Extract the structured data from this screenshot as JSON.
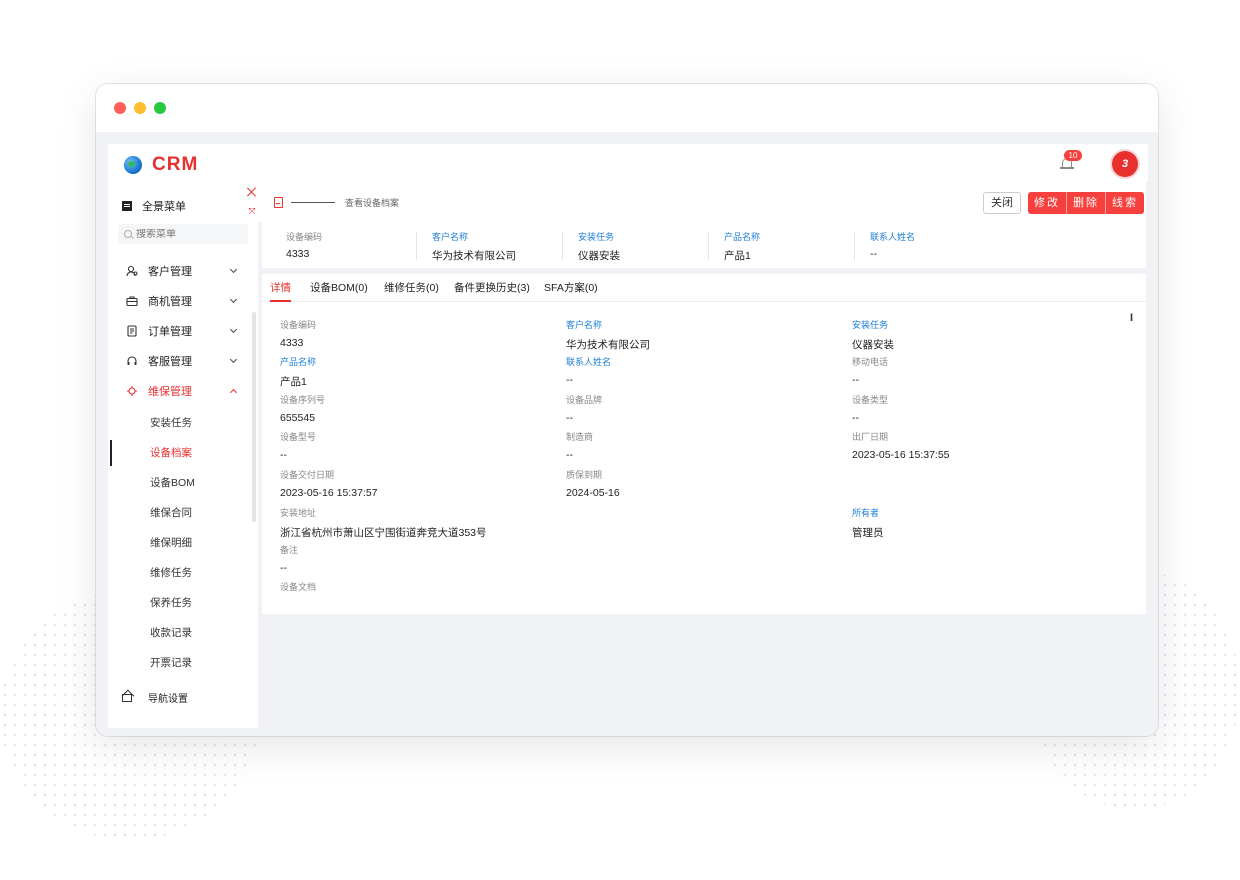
{
  "app": {
    "logo": "CRM",
    "notification_count": "10",
    "avatar_text": "3"
  },
  "sidebar": {
    "title": "全景菜单",
    "search_placeholder": "搜索菜单",
    "groups": [
      {
        "label": "客户管理",
        "icon": "customer-icon"
      },
      {
        "label": "商机管理",
        "icon": "briefcase-icon"
      },
      {
        "label": "订单管理",
        "icon": "order-icon"
      },
      {
        "label": "客服管理",
        "icon": "headset-icon"
      },
      {
        "label": "维保管理",
        "icon": "maintenance-icon"
      }
    ],
    "sub_items": [
      "安装任务",
      "设备档案",
      "设备BOM",
      "维保合同",
      "维保明细",
      "维修任务",
      "保养任务",
      "收款记录",
      "开票记录"
    ],
    "footer": "导航设置"
  },
  "header_card": {
    "breadcrumb": "查看设备档案",
    "buttons": {
      "close": "关闭",
      "edit": "修改",
      "delete": "删除",
      "clue": "线索"
    },
    "summary": [
      {
        "label": "设备编码",
        "value": "4333"
      },
      {
        "label": "客户名称",
        "value": "华为技术有限公司"
      },
      {
        "label": "安装任务",
        "value": "仪器安装"
      },
      {
        "label": "产品名称",
        "value": "产品1"
      },
      {
        "label": "联系人姓名",
        "value": "--"
      }
    ]
  },
  "tabs": [
    "详情",
    "设备BOM(0)",
    "维修任务(0)",
    "备件更换历史(3)",
    "SFA方案(0)"
  ],
  "detail_fields": [
    {
      "label": "设备编码",
      "value": "4333"
    },
    {
      "label": "客户名称",
      "value": "华为技术有限公司"
    },
    {
      "label": "安装任务",
      "value": "仪器安装"
    },
    {
      "label": "产品名称",
      "value": "产品1"
    },
    {
      "label": "联系人姓名",
      "value": "--"
    },
    {
      "label": "移动电话",
      "value": "--"
    },
    {
      "label": "设备序列号",
      "value": "655545"
    },
    {
      "label": "设备品牌",
      "value": "--"
    },
    {
      "label": "设备类型",
      "value": "--"
    },
    {
      "label": "设备型号",
      "value": "--"
    },
    {
      "label": "制造商",
      "value": "--"
    },
    {
      "label": "出厂日期",
      "value": "2023-05-16 15:37:55"
    },
    {
      "label": "设备交付日期",
      "value": "2023-05-16 15:37:57"
    },
    {
      "label": "质保到期",
      "value": "2024-05-16"
    },
    {
      "label": "安装地址",
      "value": "浙江省杭州市萧山区宁围街道奔竞大道353号"
    },
    {
      "label": "所有者",
      "value": "管理员"
    },
    {
      "label": "备注",
      "value": "--"
    },
    {
      "label": "设备文档",
      "value": ""
    }
  ],
  "colors": {
    "accent": "#e8302f",
    "link_blue": "#1e7fd8"
  }
}
